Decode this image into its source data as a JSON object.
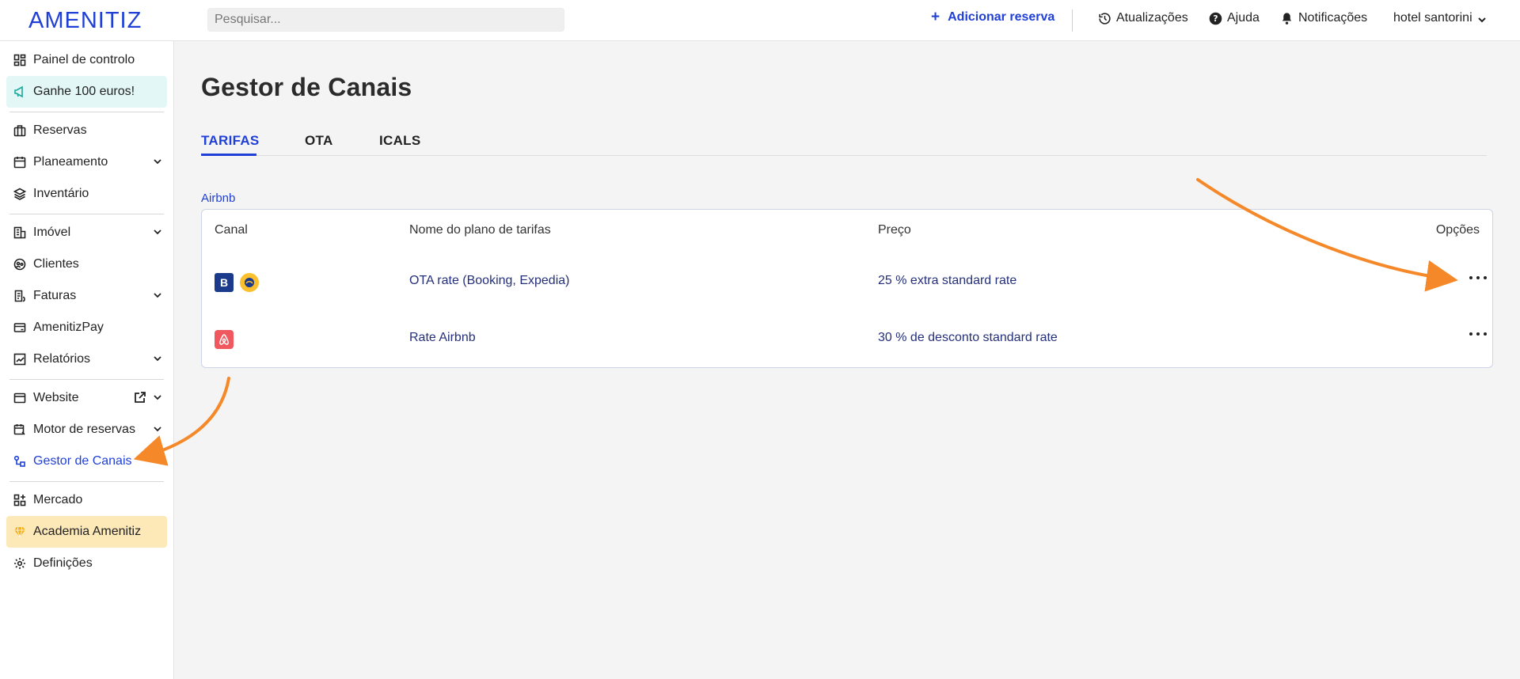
{
  "brand": {
    "logo_text": "AMENITIZ",
    "accent": "#1f3fd6"
  },
  "header": {
    "search_placeholder": "Pesquisar...",
    "add_reservation": "Adicionar reserva",
    "updates": "Atualizações",
    "help": "Ajuda",
    "notifications": "Notificações",
    "hotel": "hotel santorini"
  },
  "sidebar": {
    "items": [
      {
        "label": "Painel de controlo",
        "icon": "dashboard-icon"
      },
      {
        "label": "Ganhe 100 euros!",
        "icon": "megaphone-icon"
      },
      {
        "label": "Reservas",
        "icon": "suitcase-icon"
      },
      {
        "label": "Planeamento",
        "icon": "calendar-icon"
      },
      {
        "label": "Inventário",
        "icon": "layers-icon"
      },
      {
        "label": "Imóvel",
        "icon": "building-icon"
      },
      {
        "label": "Clientes",
        "icon": "clients-icon"
      },
      {
        "label": "Faturas",
        "icon": "invoice-icon"
      },
      {
        "label": "AmenitizPay",
        "icon": "card-icon"
      },
      {
        "label": "Relatórios",
        "icon": "chart-icon"
      },
      {
        "label": "Website",
        "icon": "browser-icon"
      },
      {
        "label": "Motor de reservas",
        "icon": "booking-engine-icon"
      },
      {
        "label": "Gestor de Canais",
        "icon": "channels-icon"
      },
      {
        "label": "Mercado",
        "icon": "market-icon"
      },
      {
        "label": "Academia Amenitiz",
        "icon": "diamond-icon"
      },
      {
        "label": "Definições",
        "icon": "gear-icon"
      }
    ]
  },
  "main": {
    "title": "Gestor de Canais",
    "tabs": [
      {
        "label": "TARIFAS",
        "active": true
      },
      {
        "label": "OTA",
        "active": false
      },
      {
        "label": "ICALS",
        "active": false
      }
    ],
    "section_label": "Airbnb",
    "table": {
      "headers": [
        "Canal",
        "Nome do plano de tarifas",
        "Preço",
        "Opções"
      ],
      "rows": [
        {
          "channels": [
            "booking-logo-icon",
            "expedia-logo-icon"
          ],
          "booking_letter": "B",
          "plan": "OTA rate (Booking, Expedia)",
          "price": "25 % extra standard rate"
        },
        {
          "channels": [
            "airbnb-logo-icon"
          ],
          "plan": "Rate Airbnb",
          "price": "30 % de desconto standard rate"
        }
      ]
    }
  },
  "annotation_color": "#f5892a"
}
